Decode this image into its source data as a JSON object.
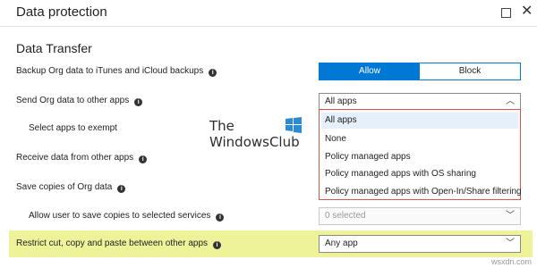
{
  "window": {
    "title": "Data protection",
    "minimize_icon": "square-icon",
    "close_icon": "close-icon"
  },
  "section": {
    "title": "Data Transfer"
  },
  "rows": {
    "backup": {
      "label": "Backup Org data to iTunes and iCloud backups",
      "toggle": {
        "allow": "Allow",
        "block": "Block",
        "selected": "Allow"
      }
    },
    "send": {
      "label": "Send Org data to other apps",
      "value": "All apps"
    },
    "exempt": {
      "label": "Select apps to exempt"
    },
    "receive": {
      "label": "Receive data from other apps"
    },
    "save_copies": {
      "label": "Save copies of Org data"
    },
    "allow_user_save": {
      "label": "Allow user to save copies to selected services",
      "value": "0 selected"
    },
    "restrict_cut": {
      "label": "Restrict cut, copy and paste between other apps",
      "value": "Any app"
    }
  },
  "dropdown": {
    "options": [
      "All apps",
      "None",
      "Policy managed apps",
      "Policy managed apps with OS sharing",
      "Policy managed apps with Open-In/Share filtering"
    ],
    "selected": "All apps"
  },
  "watermark": {
    "line1": "The",
    "line2": "WindowsClub"
  },
  "footer": {
    "source": "wsxdn.com"
  },
  "colors": {
    "accent": "#0078d4",
    "dropdown_border": "#d9534f",
    "highlight": "#eef39a"
  },
  "info_icon": "info-icon"
}
